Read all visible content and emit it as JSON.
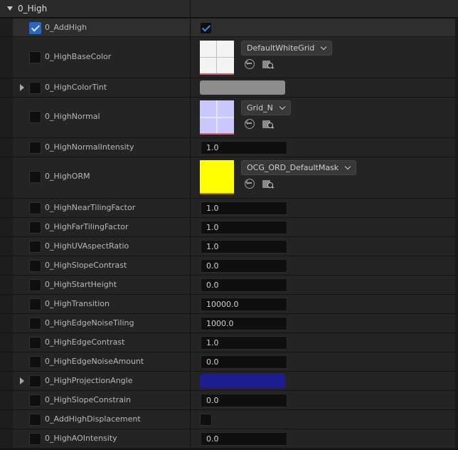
{
  "section": {
    "title": "0_High"
  },
  "rows": {
    "add_high": {
      "label": "0_AddHigh"
    },
    "base_color": {
      "label": "0_HighBaseColor",
      "asset": "DefaultWhiteGrid"
    },
    "color_tint": {
      "label": "0_HighColorTint",
      "color": "#8d8d8d"
    },
    "normal": {
      "label": "0_HighNormal",
      "asset": "Grid_N"
    },
    "normal_intensity": {
      "label": "0_HighNormalIntensity",
      "value": "1.0"
    },
    "orm": {
      "label": "0_HighORM",
      "asset": "OCG_ORD_DefaultMask"
    },
    "near_tiling": {
      "label": "0_HighNearTilingFactor",
      "value": "1.0"
    },
    "far_tiling": {
      "label": "0_HighFarTilingFactor",
      "value": "1.0"
    },
    "uv_aspect": {
      "label": "0_HighUVAspectRatio",
      "value": "1.0"
    },
    "slope_contrast": {
      "label": "0_HighSlopeContrast",
      "value": "0.0"
    },
    "start_height": {
      "label": "0_HighStartHeight",
      "value": "0.0"
    },
    "transition": {
      "label": "0_HighTransition",
      "value": "10000.0"
    },
    "edge_noise_tiling": {
      "label": "0_HighEdgeNoiseTiling",
      "value": "1000.0"
    },
    "edge_contrast": {
      "label": "0_HighEdgeContrast",
      "value": "1.0"
    },
    "edge_noise_amount": {
      "label": "0_HighEdgeNoiseAmount",
      "value": "0.0"
    },
    "projection_angle": {
      "label": "0_HighProjectionAngle",
      "color": "#1c1e8f"
    },
    "slope_constrain": {
      "label": "0_HighSlopeConstrain",
      "value": "0.0"
    },
    "add_high_displacement": {
      "label": "0_AddHighDisplacement"
    },
    "ao_intensity": {
      "label": "0_HighAOIntensity",
      "value": "0.0"
    }
  },
  "icons": {
    "section_arrow": "caret-down-icon",
    "expander": "caret-right-icon",
    "use_selected": "use-selected-asset-icon",
    "browse": "browse-to-asset-icon"
  }
}
